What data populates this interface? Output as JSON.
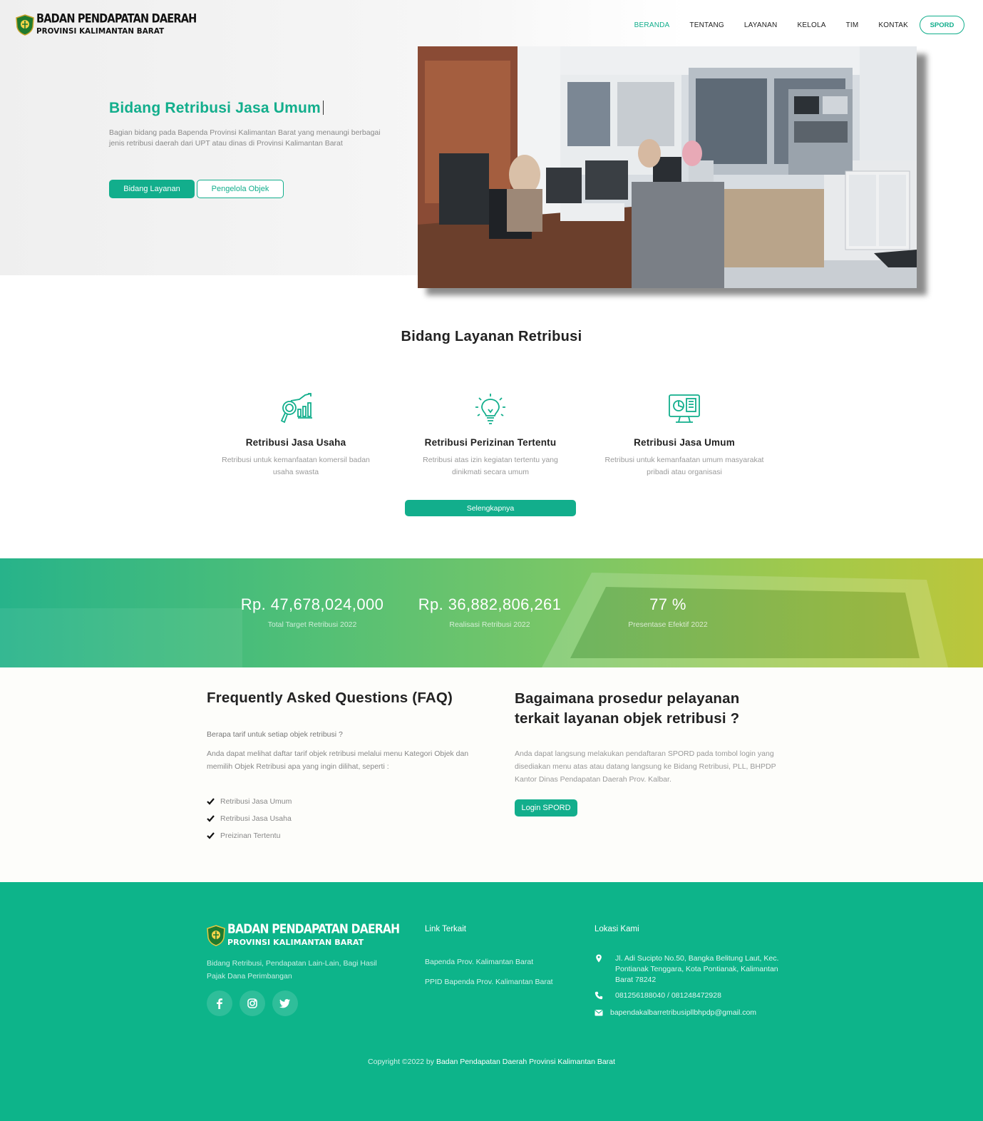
{
  "brand": {
    "line1": "BADAN PENDAPATAN DAERAH",
    "line2": "PROVINSI KALIMANTAN BARAT",
    "accent": "#12ae8c"
  },
  "nav": {
    "items": [
      "BERANDA",
      "TENTANG",
      "LAYANAN",
      "KELOLA",
      "TIM",
      "KONTAK"
    ],
    "active": "BERANDA",
    "cta": "SPORD"
  },
  "hero": {
    "title": "Bidang Retribusi Jasa Umum",
    "description": "Bagian bidang pada Bapenda Provinsi Kalimantan Barat yang menaungi berbagai jenis retribusi daerah dari UPT atau dinas di Provinsi Kalimantan Barat",
    "primary_button": "Bidang Layanan",
    "secondary_button": "Pengelola Objek",
    "photo_icon": "office-photo"
  },
  "services": {
    "title": "Bidang Layanan Retribusi",
    "items": [
      {
        "title": "Retribusi Jasa Usaha",
        "description": "Retribusi untuk kemanfaatan komersil badan usaha swasta",
        "icon": "analytics-search-icon"
      },
      {
        "title": "Retribusi Perizinan Tertentu",
        "description": "Retribusi atas izin kegiatan tertentu yang dinikmati secara umum",
        "icon": "lightbulb-idea-icon"
      },
      {
        "title": "Retribusi Jasa Umum",
        "description": "Retribusi untuk kemanfaatan umum masyarakat pribadi atau organisasi",
        "icon": "monitor-report-icon"
      }
    ],
    "more_button": "Selengkapnya"
  },
  "stats": [
    {
      "value": "Rp. 47,678,024,000",
      "label": "Total Target Retribusi 2022"
    },
    {
      "value": "Rp. 36,882,806,261",
      "label": "Realisasi Retribusi 2022"
    },
    {
      "value": "77 %",
      "label": "Presentase Efektif 2022"
    }
  ],
  "faq": {
    "title": "Frequently Asked Questions (FAQ)",
    "question": "Berapa tarif untuk setiap objek retribusi ?",
    "answer": "Anda dapat melihat daftar tarif objek retribusi melalui menu Kategori Objek dan memilih Objek Retribusi apa yang ingin dilihat, seperti :",
    "list": [
      "Retribusi Jasa Umum",
      "Retribusi Jasa Usaha",
      "Preizinan Tertentu"
    ]
  },
  "procedure": {
    "title": "Bagaimana prosedur pelayanan terkait layanan objek retribusi ?",
    "description": "Anda dapat langsung melakukan pendaftaran SPORD pada tombol login yang disediakan menu atas atau datang langsung ke Bidang Retribusi, PLL, BHPDP Kantor Dinas Pendapatan Daerah Prov. Kalbar.",
    "button": "Login SPORD"
  },
  "footer": {
    "description": "Bidang Retribusi, Pendapatan Lain-Lain, Bagi Hasil Pajak Dana Perimbangan",
    "social_icons": [
      "facebook-icon",
      "instagram-icon",
      "twitter-icon"
    ],
    "links_title": "Link Terkait",
    "links": [
      "Bapenda Prov. Kalimantan Barat",
      "PPID Bapenda Prov. Kalimantan Barat"
    ],
    "location_title": "Lokasi Kami",
    "address": "Jl. Adi Sucipto No.50, Bangka Belitung Laut, Kec. Pontianak Tenggara, Kota Pontianak, Kalimantan Barat 78242",
    "phone": "081256188040 / 081248472928",
    "email": "bapendakalbarretribusipllbhpdp@gmail.com",
    "copyright_prefix": "Copyright ©2022 by",
    "copyright_org": "Badan Pendapatan Daerah Provinsi Kalimantan Barat"
  }
}
